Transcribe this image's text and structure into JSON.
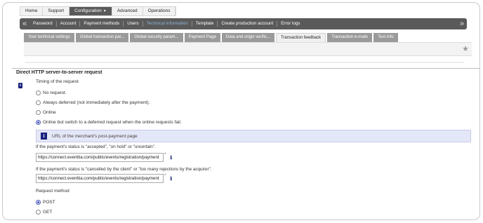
{
  "top_nav": [
    "Home",
    "Support",
    "Configuration",
    "Advanced",
    "Operations"
  ],
  "top_nav_active": "Configuration",
  "sub_nav": [
    "Password",
    "Account",
    "Payment methods",
    "Users",
    "Technical information",
    "Template",
    "Create production account",
    "Error logs"
  ],
  "sub_nav_active": "Technical information",
  "tabs": [
    "Your technical settings",
    "Global transaction par...",
    "Global security param...",
    "Payment Page",
    "Data and origin verific...",
    "Transaction feedback",
    "Transaction e-mails",
    "Test info"
  ],
  "tabs_active": "Transaction feedback",
  "section": {
    "title": "Direct HTTP server-to-server request",
    "timing_label": "Timing of the request",
    "timing_options": [
      "No request.",
      "Always deferred (not immediately after the payment).",
      "Online",
      "Online but switch to a deferred request when the online requests fail."
    ],
    "timing_selected": 3,
    "info_text": "URL of the merchant's post-payment page",
    "url1_label": "If the payment's status is \"accepted\", \"on hold\" or \"uncertain\".",
    "url1_value": "https://connect.eventtia.com/public/events/registration/payment",
    "url2_label": "If the payment's status is \"cancelled by the client\" or \"too many rejections by the acquirer\".",
    "url2_value": "https://connect.eventtia.com/public/events/registration/payment",
    "method_label": "Request method",
    "method_options": [
      "POST",
      "GET"
    ],
    "method_selected": 0
  },
  "icons": {
    "left_arrow": "double-chevron-left-icon",
    "right_arrow": "double-chevron-right-icon",
    "star": "star-icon",
    "info": "info-icon"
  },
  "colors": {
    "nav_dark": "#5a5a5a",
    "tab_gray": "#9a9a9a",
    "info_bg": "#e4e7f7",
    "accent": "#1a237e"
  }
}
